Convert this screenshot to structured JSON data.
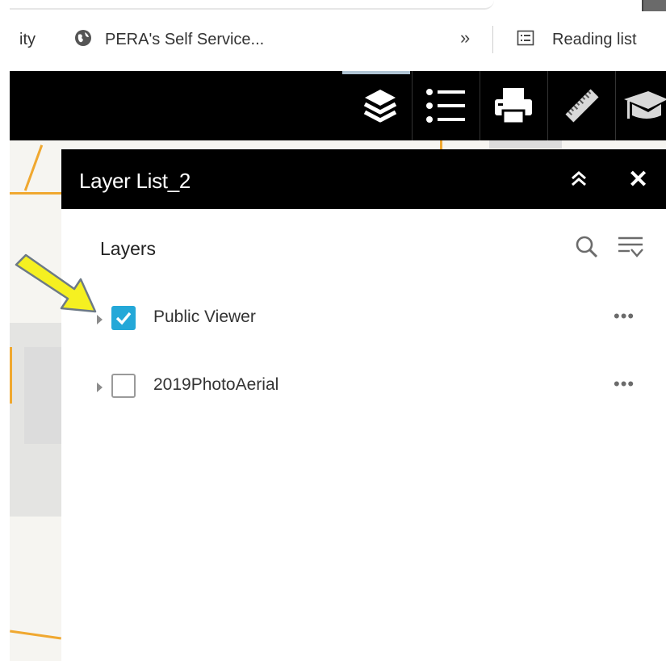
{
  "browser": {
    "bookmarks": [
      {
        "label": "ity"
      },
      {
        "label": "PERA's Self Service..."
      }
    ],
    "overflow_label": "»",
    "reading_list_label": "Reading list"
  },
  "toolbar": {
    "icons": [
      "layers-icon",
      "legend-icon",
      "print-icon",
      "measure-icon",
      "education-icon"
    ]
  },
  "panel": {
    "title": "Layer List_2",
    "collapse_label": "≈",
    "close_label": "✕",
    "layers_heading": "Layers",
    "layers": [
      {
        "name": "Public Viewer",
        "checked": true,
        "more_label": "•••"
      },
      {
        "name": "2019PhotoAerial",
        "checked": false,
        "more_label": "•••"
      }
    ]
  },
  "colors": {
    "checkbox_checked": "#24a8d8",
    "header_bg": "#000000",
    "annotation_arrow": "#f5f021"
  }
}
